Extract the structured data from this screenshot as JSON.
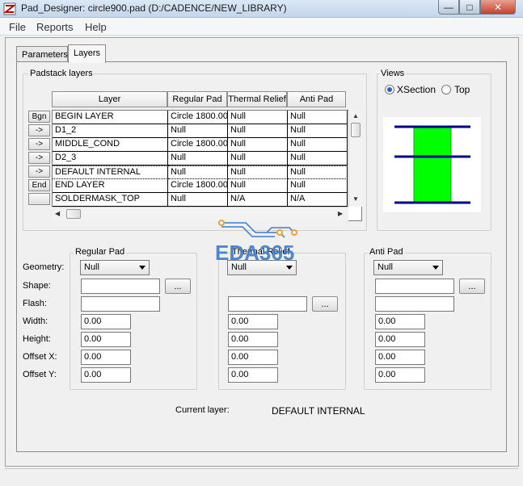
{
  "window": {
    "title": "Pad_Designer: circle900.pad (D:/CADENCE/NEW_LIBRARY)",
    "min_label": "—",
    "max_label": "□",
    "close_label": "✕"
  },
  "menu": {
    "items": [
      "File",
      "Reports",
      "Help"
    ]
  },
  "tabs": {
    "items": [
      "Parameters",
      "Layers"
    ],
    "active": "Layers"
  },
  "padstack": {
    "group_label": "Padstack layers",
    "columns": [
      "Layer",
      "Regular Pad",
      "Thermal Relief",
      "Anti Pad"
    ],
    "row_buttons": [
      "Bgn",
      "->",
      "->",
      "->",
      "->",
      "End",
      ""
    ],
    "rows": [
      [
        "BEGIN LAYER",
        "Circle 1800.00",
        "Null",
        "Null"
      ],
      [
        "D1_2",
        "Null",
        "Null",
        "Null"
      ],
      [
        "MIDDLE_COND",
        "Circle 1800.00",
        "Null",
        "Null"
      ],
      [
        "D2_3",
        "Null",
        "Null",
        "Null"
      ],
      [
        "DEFAULT INTERNAL",
        "Null",
        "Null",
        "Null"
      ],
      [
        "END LAYER",
        "Circle 1800.00",
        "Null",
        "Null"
      ],
      [
        "SOLDERMASK_TOP",
        "Null",
        "N/A",
        "N/A"
      ]
    ],
    "selected_row": 4
  },
  "views": {
    "group_label": "Views",
    "options": [
      "XSection",
      "Top"
    ],
    "selected": "XSection",
    "colors": {
      "pad_fill": "#00ff00",
      "layer_line": "#00008b"
    }
  },
  "field_labels": [
    "Geometry:",
    "Shape:",
    "Flash:",
    "Width:",
    "Height:",
    "Offset X:",
    "Offset Y:"
  ],
  "regular_pad": {
    "group_label": "Regular Pad",
    "geometry": "Null",
    "shape": "",
    "flash": "",
    "width": "0.00",
    "height": "0.00",
    "offset_x": "0.00",
    "offset_y": "0.00"
  },
  "thermal_relief": {
    "group_label": "Thermal Relief",
    "geometry": "Null",
    "flash": "",
    "width": "0.00",
    "height": "0.00",
    "offset_x": "0.00",
    "offset_y": "0.00"
  },
  "anti_pad": {
    "group_label": "Anti Pad",
    "geometry": "Null",
    "shape": "",
    "flash": "",
    "width": "0.00",
    "height": "0.00",
    "offset_x": "0.00",
    "offset_y": "0.00"
  },
  "browse_label": "...",
  "current_layer": {
    "label": "Current layer:",
    "value": "DEFAULT INTERNAL"
  },
  "watermark": {
    "text": "EDA365",
    "color": "#3d7cc9",
    "accent": "#f0a030"
  }
}
